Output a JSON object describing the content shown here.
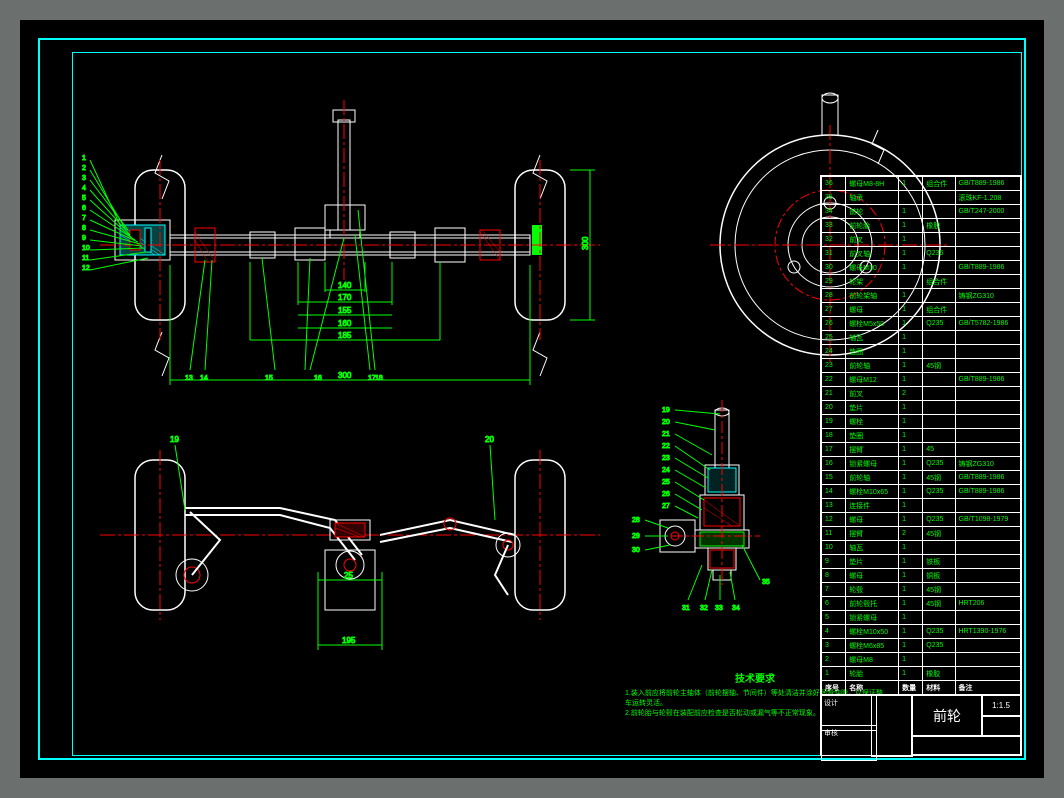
{
  "drawing": {
    "title": "前轮",
    "scale": "1:1.5",
    "sheet": "",
    "material": "",
    "designer": "",
    "checker": ""
  },
  "tech_notes": {
    "heading": "技术要求",
    "line1": "1.装入前应将前轮主轴体（前轮摆轴、节间件）等处清洁并涂好润滑油脂，以保证整车运转灵活。",
    "line2": "2.前轮胎与轮毂在装配前应检查是否松动或漏气等不正常现象。"
  },
  "dimensions": {
    "front_elevation": [
      "170",
      "140",
      "155",
      "160",
      "185",
      "300"
    ],
    "top_view": [
      "25",
      "195"
    ],
    "detail": [
      "28"
    ]
  },
  "balloons_front": [
    "1",
    "2",
    "3",
    "4",
    "5",
    "6",
    "7",
    "8",
    "9",
    "10",
    "11",
    "12"
  ],
  "balloons_mid": [
    "13",
    "14",
    "15",
    "16",
    "17",
    "18"
  ],
  "balloons_top": [
    "19",
    "20"
  ],
  "balloons_detail": [
    "19",
    "20",
    "21",
    "22",
    "23",
    "24",
    "25",
    "26",
    "27",
    "28",
    "29",
    "30",
    "31",
    "32",
    "33",
    "34",
    "35"
  ],
  "bom_header": {
    "no": "序号",
    "name": "名称",
    "qty": "数量",
    "mat": "材料",
    "note": "备注"
  },
  "bom": [
    {
      "no": "36",
      "name": "螺母M8-8H",
      "qty": "1",
      "mat": "组合件",
      "note": "GB/T889-1986"
    },
    {
      "no": "35",
      "name": "轴承",
      "qty": "",
      "mat": "",
      "note": "滚珠KF-1.208"
    },
    {
      "no": "34",
      "name": "前轮",
      "qty": "1",
      "mat": "",
      "note": "GB/T247-2000"
    },
    {
      "no": "33",
      "name": "前轮胎",
      "qty": "1",
      "mat": "橡胶",
      "note": ""
    },
    {
      "no": "32",
      "name": "前叉",
      "qty": "1",
      "mat": "",
      "note": ""
    },
    {
      "no": "31",
      "name": "前叉轴",
      "qty": "1",
      "mat": "Q235",
      "note": ""
    },
    {
      "no": "30",
      "name": "螺母M10",
      "qty": "1",
      "mat": "",
      "note": "GB/T889-1986"
    },
    {
      "no": "29",
      "name": "轮架",
      "qty": "",
      "mat": "组合件",
      "note": ""
    },
    {
      "no": "28",
      "name": "前轮架轴",
      "qty": "1",
      "mat": "",
      "note": "铸钢ZG310"
    },
    {
      "no": "27",
      "name": "螺母",
      "qty": "1",
      "mat": "组合件",
      "note": ""
    },
    {
      "no": "26",
      "name": "螺栓M5x50",
      "qty": "1",
      "mat": "Q235",
      "note": "GB/T5782-1986"
    },
    {
      "no": "25",
      "name": "轴瓦",
      "qty": "1",
      "mat": "",
      "note": ""
    },
    {
      "no": "24",
      "name": "垫圈",
      "qty": "1",
      "mat": "",
      "note": ""
    },
    {
      "no": "23",
      "name": "前轮轴",
      "qty": "1",
      "mat": "45钢",
      "note": ""
    },
    {
      "no": "22",
      "name": "螺母M12",
      "qty": "1",
      "mat": "",
      "note": "GB/T889-1986"
    },
    {
      "no": "21",
      "name": "前叉",
      "qty": "2",
      "mat": "",
      "note": ""
    },
    {
      "no": "20",
      "name": "垫片",
      "qty": "1",
      "mat": "",
      "note": ""
    },
    {
      "no": "19",
      "name": "螺栓",
      "qty": "1",
      "mat": "",
      "note": ""
    },
    {
      "no": "18",
      "name": "垫圈",
      "qty": "1",
      "mat": "",
      "note": ""
    },
    {
      "no": "17",
      "name": "摆臂",
      "qty": "1",
      "mat": "45",
      "note": ""
    },
    {
      "no": "16",
      "name": "锁紧螺母",
      "qty": "1",
      "mat": "Q235",
      "note": "铸钢ZG310"
    },
    {
      "no": "15",
      "name": "前轮轴",
      "qty": "1",
      "mat": "45钢",
      "note": "GB/T889-1986"
    },
    {
      "no": "14",
      "name": "螺栓M10x65",
      "qty": "1",
      "mat": "Q235",
      "note": "GB/T889-1986"
    },
    {
      "no": "13",
      "name": "连接件",
      "qty": "1",
      "mat": "",
      "note": ""
    },
    {
      "no": "12",
      "name": "螺母",
      "qty": "1",
      "mat": "Q235",
      "note": "GB/T1098-1979"
    },
    {
      "no": "11",
      "name": "摆臂",
      "qty": "2",
      "mat": "45钢",
      "note": ""
    },
    {
      "no": "10",
      "name": "轴瓦",
      "qty": "1",
      "mat": "",
      "note": ""
    },
    {
      "no": "9",
      "name": "垫片",
      "qty": "1",
      "mat": "铁板",
      "note": ""
    },
    {
      "no": "8",
      "name": "螺母",
      "qty": "1",
      "mat": "铜板",
      "note": ""
    },
    {
      "no": "7",
      "name": "轮毂",
      "qty": "1",
      "mat": "45钢",
      "note": ""
    },
    {
      "no": "6",
      "name": "前轮毂托",
      "qty": "1",
      "mat": "45钢",
      "note": "HRT206"
    },
    {
      "no": "5",
      "name": "锁紧螺母",
      "qty": "1",
      "mat": "",
      "note": ""
    },
    {
      "no": "4",
      "name": "螺栓M10x50",
      "qty": "1",
      "mat": "Q235",
      "note": "HRT1390-1976"
    },
    {
      "no": "3",
      "name": "螺栓M6x85",
      "qty": "1",
      "mat": "Q235",
      "note": ""
    },
    {
      "no": "2",
      "name": "螺母M8",
      "qty": "1",
      "mat": "",
      "note": ""
    },
    {
      "no": "1",
      "name": "轮胎",
      "qty": "1",
      "mat": "橡胶",
      "note": ""
    }
  ]
}
